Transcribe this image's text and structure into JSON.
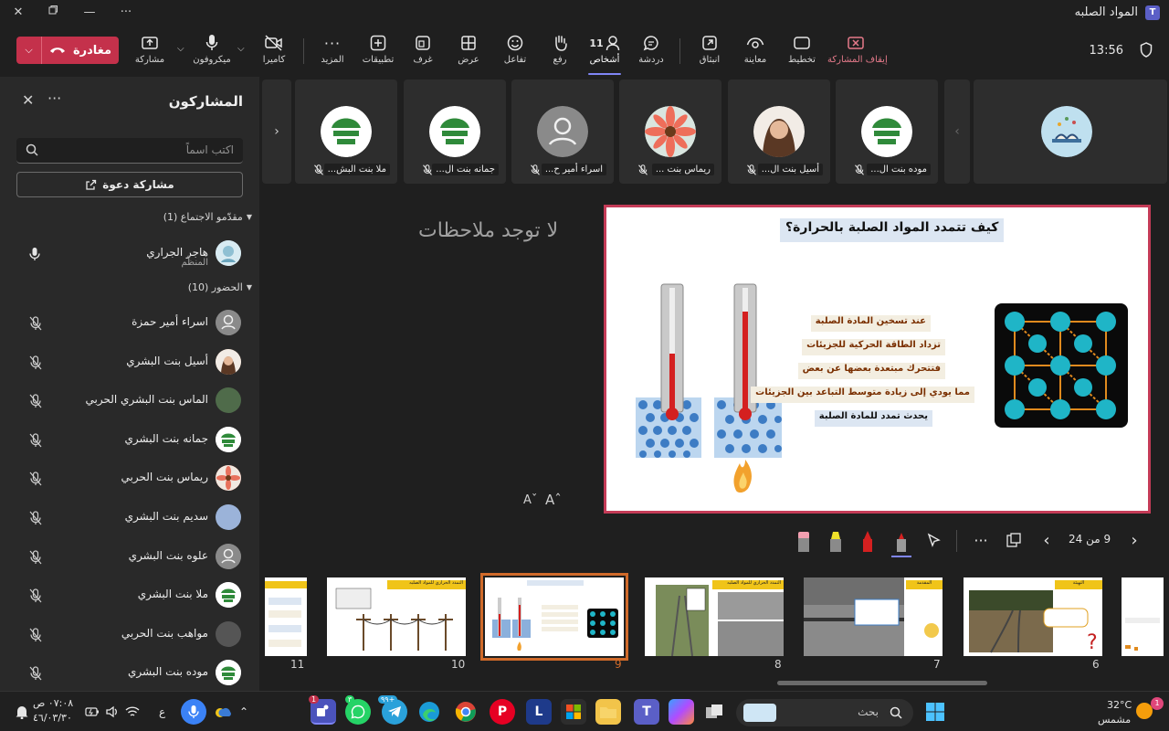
{
  "window": {
    "title": "المواد الصلبه"
  },
  "toolbar": {
    "leave_label": "مغادرة",
    "share_label": "مشاركة",
    "mic_label": "ميكروفون",
    "camera_label": "كاميرا",
    "more_label": "المزيد",
    "apps_label": "تطبيقات",
    "rooms_label": "غرف",
    "view_label": "عرض",
    "react_label": "تفاعل",
    "raise_label": "رفع",
    "people_label": "أشخاص",
    "people_count": "11",
    "chat_label": "دردشة",
    "popout_label": "انبثاق",
    "preview_label": "معاينة",
    "layout_label": "تخطيط",
    "stop_share_label": "إيقاف المشاركة",
    "time": "13:56"
  },
  "panel": {
    "title": "المشاركون",
    "search_placeholder": "اكتب اسماً",
    "invite_label": "مشاركة دعوة",
    "presenters_section": "مقدّمو الاجتماع (1)",
    "attendees_section": "الحضور (10)",
    "organizer": {
      "name": "هاجر الجراري",
      "role": "المنظّم"
    },
    "attendees": [
      {
        "name": "اسراء أمير حمزة"
      },
      {
        "name": "أسيل بنت البشري"
      },
      {
        "name": "الماس بنت البشري الحربي"
      },
      {
        "name": "جمانه بنت البشري"
      },
      {
        "name": "ريماس بنت الحربي"
      },
      {
        "name": "سديم بنت البشري"
      },
      {
        "name": "علوه بنت البشري"
      },
      {
        "name": "ملا بنت البشري"
      },
      {
        "name": "مواهب بنت الحربي"
      },
      {
        "name": "موده بنت البشري"
      }
    ]
  },
  "gallery": {
    "tiles": [
      {
        "name": "ملا بنت البش..."
      },
      {
        "name": "جمانه بنت ال..."
      },
      {
        "name": "اسراء أمير ح..."
      },
      {
        "name": "ريماس بنت ..."
      },
      {
        "name": "أسيل بنت ال..."
      },
      {
        "name": "موده بنت ال..."
      }
    ]
  },
  "notes": {
    "empty_label": "لا توجد ملاحظات",
    "font_small": "Aˇ",
    "font_large": "Aˆ"
  },
  "slide": {
    "title": "كيف تتمدد المواد الصلبة بالحرارة؟",
    "bullets": [
      "عند تسخين المادة الصلبة",
      "تزداد الطاقة الحركية للجزيئات",
      "فتتحرك مبتعدة بعضها عن بعض",
      "مما يودي إلى زيادة متوسط التباعد بين الجزيئات",
      "يحدث تمدد للمادة الصلبة"
    ]
  },
  "slide_nav": {
    "page_label": "9 من 24"
  },
  "thumbnails": [
    {
      "num": "11"
    },
    {
      "num": "10"
    },
    {
      "num": "9"
    },
    {
      "num": "8"
    },
    {
      "num": "7"
    },
    {
      "num": "6"
    }
  ],
  "thumb_titles": {
    "t10": "التمدد الحراري للمواد الصلبه",
    "t8": "التمدد الحراري للمواد الصلبه",
    "t7": "المقدمة",
    "t6": "التهيئة"
  },
  "taskbar": {
    "search_placeholder": "بحث",
    "weather_temp": "32°C",
    "weather_desc": "مشمس",
    "time": "٠٧:٠٨ ص",
    "date": "٤٦/٠٣/٣٠",
    "lang": "ع",
    "teams_badge": "1",
    "whatsapp_badge": "٣",
    "telegram_badge": "٩٩+",
    "weather_badge": "1"
  },
  "colors": {
    "leave": "#c4314b",
    "accent": "#7f85f5",
    "slide_border": "#c43b57",
    "thumb_selected": "#d06a2a"
  }
}
